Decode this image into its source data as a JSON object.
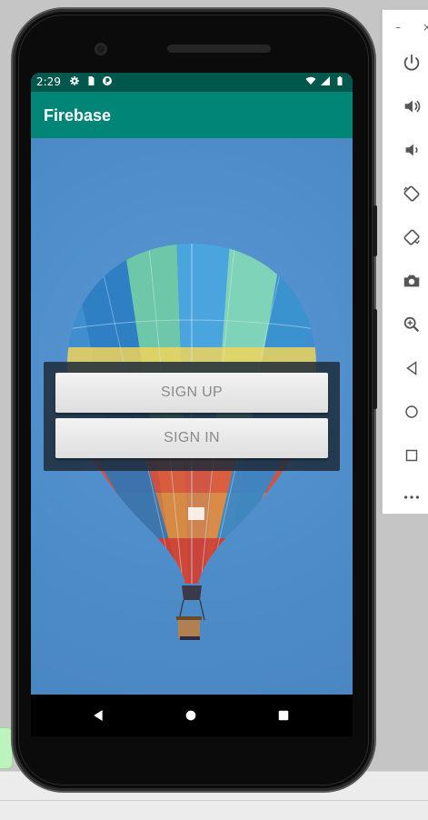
{
  "status_bar": {
    "time": "2:29",
    "left_icons": [
      "settings-icon",
      "sim-card-icon",
      "app-notification-icon"
    ],
    "right_icons": [
      "wifi-icon",
      "cell-signal-icon",
      "battery-icon"
    ]
  },
  "app_bar": {
    "title": "Firebase"
  },
  "buttons": {
    "sign_up": "SIGN UP",
    "sign_in": "SIGN IN"
  },
  "nav_bar": {
    "items": [
      "back-icon",
      "home-icon",
      "recents-icon"
    ]
  },
  "emulator_panel": {
    "window_controls": [
      "minimize-icon",
      "close-icon"
    ],
    "minimize_glyph": "–",
    "close_glyph": "×",
    "tools": [
      "power-icon",
      "volume-up-icon",
      "volume-down-icon",
      "rotate-left-icon",
      "rotate-right-icon",
      "camera-icon",
      "zoom-icon",
      "back-icon",
      "home-icon",
      "overview-icon",
      "more-icon"
    ]
  },
  "colors": {
    "status_bar": "#00574b",
    "app_bar": "#008577",
    "background": "#4e8ecb",
    "button_text": "#8a8a8a"
  }
}
